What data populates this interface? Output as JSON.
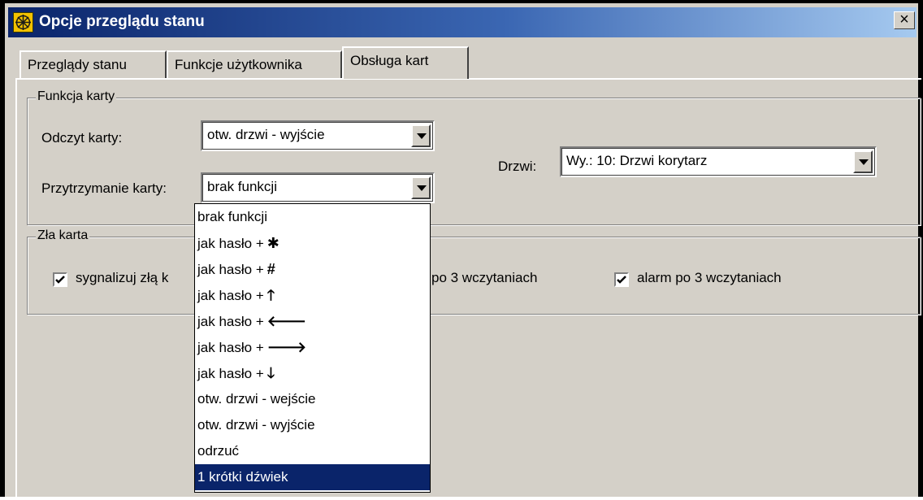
{
  "window": {
    "title": "Opcje przeglądu stanu",
    "close_label": "×"
  },
  "tabs": [
    {
      "label": "Przeglądy stanu"
    },
    {
      "label": "Funkcje użytkownika"
    },
    {
      "label": "Obsługa kart",
      "active": true
    }
  ],
  "card_function": {
    "group_label": "Funkcja karty",
    "read_label": "Odczyt karty:",
    "read_value": "otw. drzwi - wyjście",
    "hold_label": "Przytrzymanie karty:",
    "hold_value": "brak funkcji",
    "door_label": "Drzwi:",
    "door_value": "Wy.: 10: Drzwi korytarz"
  },
  "bad_card": {
    "group_label": "Zła karta",
    "signal_label": "sygnalizuj złą k",
    "signal_checked": true,
    "after3_label": "po 3 wczytaniach",
    "alarm_label": "alarm po 3 wczytaniach",
    "alarm_checked": true
  },
  "hold_dropdown": {
    "options": [
      {
        "text": "brak funkcji",
        "symbol": ""
      },
      {
        "text": "jak hasło +",
        "symbol": "✱"
      },
      {
        "text": "jak hasło +",
        "symbol": "#"
      },
      {
        "text": "jak hasło +",
        "symbol": "🡑"
      },
      {
        "text": "jak hasło +",
        "symbol": "🡐"
      },
      {
        "text": "jak hasło +",
        "symbol": "🡒"
      },
      {
        "text": "jak hasło +",
        "symbol": "🡓"
      },
      {
        "text": "otw. drzwi - wejście",
        "symbol": ""
      },
      {
        "text": "otw. drzwi - wyjście",
        "symbol": ""
      },
      {
        "text": "odrzuć",
        "symbol": ""
      },
      {
        "text": "1 krótki dźwiek",
        "symbol": "",
        "selected": true
      }
    ]
  },
  "colors": {
    "titlebar": "#0a246a",
    "face": "#d4d0c8",
    "highlight": "#0a246a"
  }
}
